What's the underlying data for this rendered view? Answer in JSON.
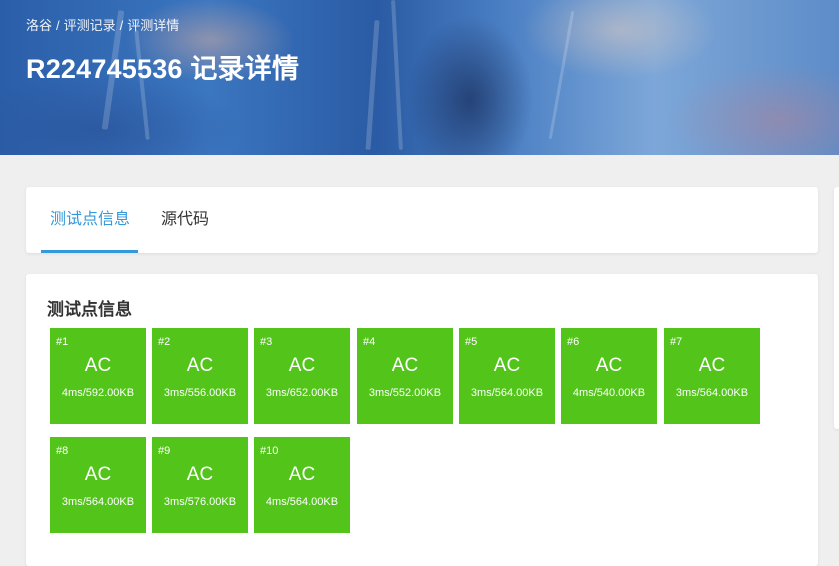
{
  "header": {
    "breadcrumb": [
      "洛谷",
      "评测记录",
      "评测详情"
    ],
    "breadcrumb_sep": "/",
    "title": "R224745536 记录详情"
  },
  "tabs": [
    {
      "label": "测试点信息",
      "active": true
    },
    {
      "label": "源代码",
      "active": false
    }
  ],
  "section": {
    "title": "测试点信息"
  },
  "colors": {
    "accent": "#3498db",
    "ac_green": "#52c41a",
    "background": "#efefef"
  },
  "testcases": [
    {
      "id": "#1",
      "status": "AC",
      "meta": "4ms/592.00KB"
    },
    {
      "id": "#2",
      "status": "AC",
      "meta": "3ms/556.00KB"
    },
    {
      "id": "#3",
      "status": "AC",
      "meta": "3ms/652.00KB"
    },
    {
      "id": "#4",
      "status": "AC",
      "meta": "3ms/552.00KB"
    },
    {
      "id": "#5",
      "status": "AC",
      "meta": "3ms/564.00KB"
    },
    {
      "id": "#6",
      "status": "AC",
      "meta": "4ms/540.00KB"
    },
    {
      "id": "#7",
      "status": "AC",
      "meta": "3ms/564.00KB"
    },
    {
      "id": "#8",
      "status": "AC",
      "meta": "3ms/564.00KB"
    },
    {
      "id": "#9",
      "status": "AC",
      "meta": "3ms/576.00KB"
    },
    {
      "id": "#10",
      "status": "AC",
      "meta": "4ms/564.00KB"
    }
  ]
}
